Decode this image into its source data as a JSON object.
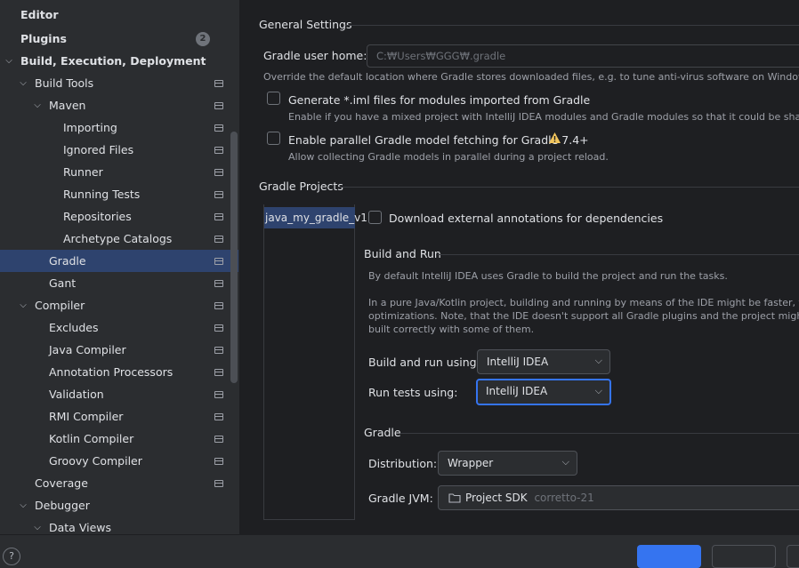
{
  "sidebar": {
    "items": [
      {
        "label": "Editor",
        "bold": true
      },
      {
        "label": "Plugins",
        "bold": true,
        "badge": "2"
      },
      {
        "label": "Build, Execution, Deployment",
        "bold": true,
        "expanded": true
      },
      {
        "label": "Build Tools",
        "expanded": true
      },
      {
        "label": "Maven",
        "expanded": true
      },
      {
        "label": "Importing"
      },
      {
        "label": "Ignored Files"
      },
      {
        "label": "Runner"
      },
      {
        "label": "Running Tests"
      },
      {
        "label": "Repositories"
      },
      {
        "label": "Archetype Catalogs"
      },
      {
        "label": "Gradle",
        "selected": true
      },
      {
        "label": "Gant"
      },
      {
        "label": "Compiler",
        "expanded": true
      },
      {
        "label": "Excludes"
      },
      {
        "label": "Java Compiler"
      },
      {
        "label": "Annotation Processors"
      },
      {
        "label": "Validation"
      },
      {
        "label": "RMI Compiler"
      },
      {
        "label": "Kotlin Compiler"
      },
      {
        "label": "Groovy Compiler"
      },
      {
        "label": "Coverage"
      },
      {
        "label": "Debugger",
        "expanded": true
      },
      {
        "label": "Data Views",
        "expanded": true
      }
    ]
  },
  "general": {
    "title": "General Settings",
    "user_home_label": "Gradle user home:",
    "user_home_placeholder": "C:₩Users₩GGG₩.gradle",
    "user_home_hint": "Override the default location where Gradle stores downloaded files, e.g. to tune anti-virus software on Windows",
    "iml_label": "Generate *.iml files for modules imported from Gradle",
    "iml_hint": "Enable if you have a mixed project with IntelliJ IDEA modules and Gradle modules so that it could be shared vi",
    "parallel_label": "Enable parallel Gradle model fetching for Gradle 7.4+",
    "parallel_hint": "Allow collecting Gradle models in parallel during a project reload."
  },
  "projects": {
    "title": "Gradle Projects",
    "items": [
      "java_my_gradle_v1"
    ],
    "download_annotations_label": "Download external annotations for dependencies"
  },
  "build_run": {
    "title": "Build and Run",
    "desc1": "By default IntelliJ IDEA uses Gradle to build the project and run the tasks.",
    "desc2_line1": "In a pure Java/Kotlin project, building and running by means of the IDE might be faster, thanks",
    "desc2_line2": "optimizations. Note, that the IDE doesn't support all Gradle plugins and the project might no",
    "desc2_line3": "built correctly with some of them.",
    "build_using_label": "Build and run using:",
    "build_using_value": "IntelliJ IDEA",
    "tests_using_label": "Run tests using:",
    "tests_using_value": "IntelliJ IDEA"
  },
  "gradle": {
    "title": "Gradle",
    "distribution_label": "Distribution:",
    "distribution_value": "Wrapper",
    "jvm_label": "Gradle JVM:",
    "jvm_value": "Project SDK",
    "jvm_detail": "corretto-21"
  },
  "bottom": {
    "help_label": "?"
  }
}
